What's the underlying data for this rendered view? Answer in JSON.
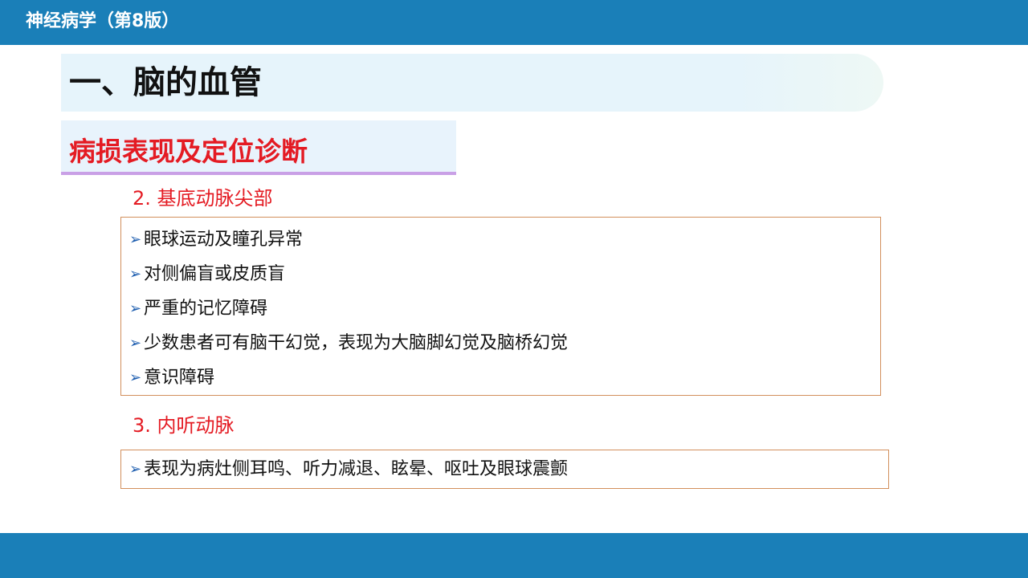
{
  "header": {
    "book_title": "神经病学（第8版）"
  },
  "section": {
    "title": "一、脑的血管"
  },
  "subsection": {
    "title": "病损表现及定位诊断"
  },
  "groups": [
    {
      "heading": "2. 基底动脉尖部",
      "items": [
        "眼球运动及瞳孔异常",
        "对侧偏盲或皮质盲",
        "严重的记忆障碍",
        "少数患者可有脑干幻觉，表现为大脑脚幻觉及脑桥幻觉",
        "意识障碍"
      ]
    },
    {
      "heading": "3. 内听动脉",
      "items": [
        "表现为病灶侧耳鸣、听力减退、眩晕、呕吐及眼球震颤"
      ]
    }
  ],
  "colors": {
    "bar": "#1a7fb8",
    "heading_red": "#e41b23",
    "bullet_blue": "#1f5fb0",
    "box_border": "#d28f5c"
  },
  "icons": {
    "bullet": "arrow-bullet-icon"
  }
}
